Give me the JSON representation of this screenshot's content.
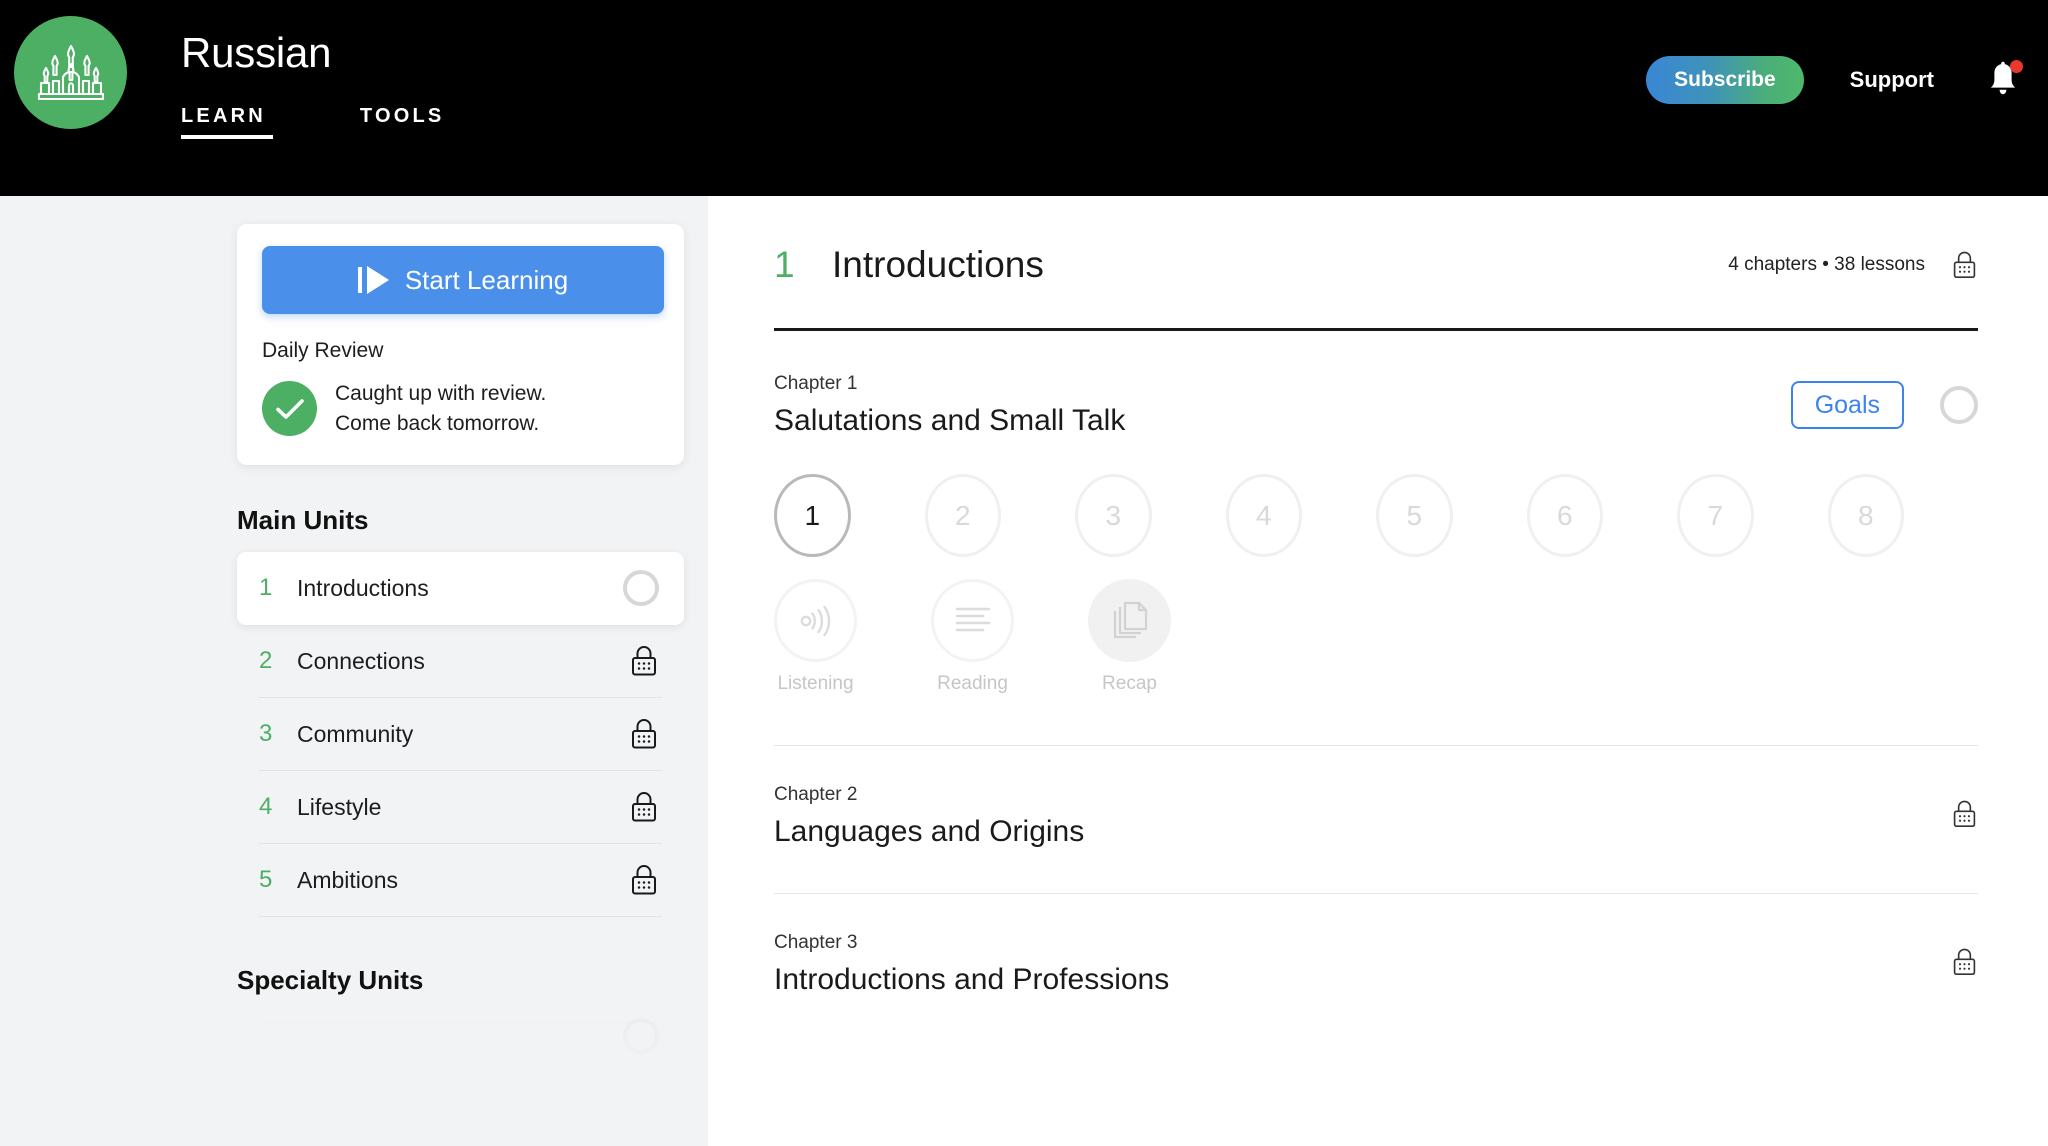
{
  "header": {
    "logo_icon": "cathedral-icon",
    "title": "Russian",
    "tabs": [
      {
        "label": "LEARN",
        "active": true
      },
      {
        "label": "TOOLS",
        "active": false
      }
    ],
    "subscribe_label": "Subscribe",
    "support_label": "Support",
    "bell_icon": "notification-bell-icon",
    "has_notification": true,
    "colors": {
      "bg": "#000000",
      "logo_green": "#4caf64",
      "subscribe_from": "#3a86d6",
      "subscribe_to": "#4eb96a",
      "badge_red": "#e8392c"
    }
  },
  "sidebar": {
    "start_button_label": "Start Learning",
    "start_button_icon": "play-icon",
    "daily_review_title": "Daily Review",
    "daily_review_status_icon": "check-circle-icon",
    "daily_review_line1": "Caught up with review.",
    "daily_review_line2": "Come back tomorrow.",
    "main_units_heading": "Main Units",
    "units": [
      {
        "num": "1",
        "label": "Introductions",
        "state": "active",
        "indicator": "progress-ring"
      },
      {
        "num": "2",
        "label": "Connections",
        "state": "locked",
        "indicator": "lock-icon"
      },
      {
        "num": "3",
        "label": "Community",
        "state": "locked",
        "indicator": "lock-icon"
      },
      {
        "num": "4",
        "label": "Lifestyle",
        "state": "locked",
        "indicator": "lock-icon"
      },
      {
        "num": "5",
        "label": "Ambitions",
        "state": "locked",
        "indicator": "lock-icon"
      }
    ],
    "specialty_units_heading": "Specialty Units",
    "colors": {
      "bg": "#f2f3f4",
      "accent_green": "#4caf64",
      "start_blue": "#4a90ea"
    }
  },
  "main": {
    "unit_number": "1",
    "unit_title": "Introductions",
    "unit_meta": "4 chapters • 38 lessons",
    "unit_lock_icon": "lock-icon",
    "chapters": [
      {
        "kicker": "Chapter 1",
        "name": "Salutations and Small Talk",
        "locked": false,
        "goals_label": "Goals",
        "progress_indicator": "progress-ring",
        "lessons": [
          {
            "num": "1",
            "state": "current"
          },
          {
            "num": "2",
            "state": "locked"
          },
          {
            "num": "3",
            "state": "locked"
          },
          {
            "num": "4",
            "state": "locked"
          },
          {
            "num": "5",
            "state": "locked"
          },
          {
            "num": "6",
            "state": "locked"
          },
          {
            "num": "7",
            "state": "locked"
          },
          {
            "num": "8",
            "state": "locked"
          }
        ],
        "activities": [
          {
            "label": "Listening",
            "icon": "sound-wave-icon",
            "filled": false
          },
          {
            "label": "Reading",
            "icon": "text-lines-icon",
            "filled": false
          },
          {
            "label": "Recap",
            "icon": "stacked-pages-icon",
            "filled": true
          }
        ]
      },
      {
        "kicker": "Chapter 2",
        "name": "Languages and Origins",
        "locked": true,
        "lock_icon": "lock-icon"
      },
      {
        "kicker": "Chapter 3",
        "name": "Introductions and Professions",
        "locked": true,
        "lock_icon": "lock-icon"
      }
    ],
    "colors": {
      "bg": "#ffffff",
      "accent_green": "#4caf64",
      "goals_blue": "#3b83f0",
      "rule_dark": "#1a1a1a"
    }
  }
}
